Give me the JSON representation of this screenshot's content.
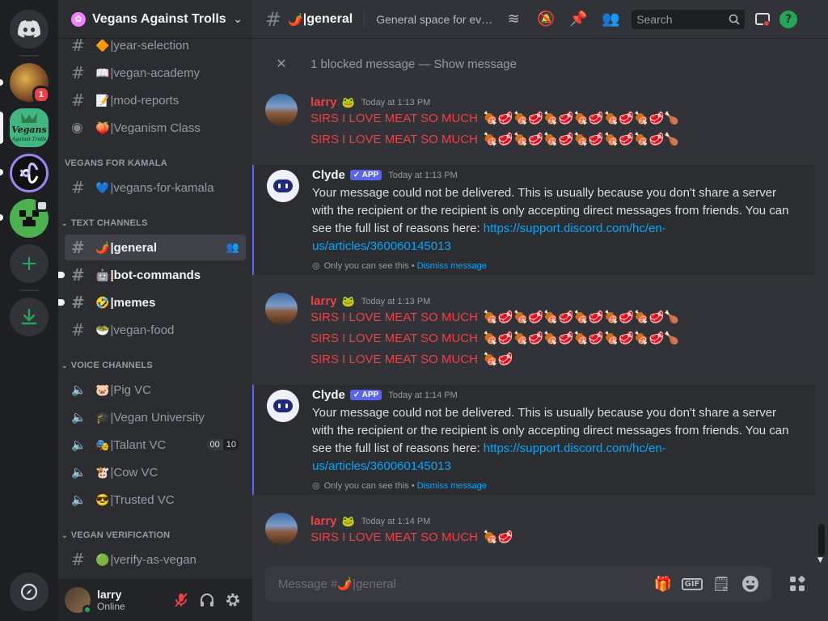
{
  "server": {
    "name": "Vegans Against Trolls"
  },
  "rail": {
    "mention_count": "1",
    "server_logo_text": "Vegans Against Trolls"
  },
  "channels": [
    {
      "type": "text",
      "emoji": "🔶",
      "name": "|year-selection",
      "active": false,
      "unread": false
    },
    {
      "type": "text",
      "emoji": "📖",
      "name": "|vegan-academy",
      "active": false,
      "unread": false
    },
    {
      "type": "text",
      "emoji": "📝",
      "name": "|mod-reports",
      "active": false,
      "unread": false
    },
    {
      "type": "stage",
      "emoji": "🍑",
      "name": "|Veganism Class",
      "active": false,
      "unread": false
    }
  ],
  "categories": {
    "kamala": "VEGANS FOR KAMALA",
    "text": "TEXT CHANNELS",
    "voice": "VOICE CHANNELS",
    "verification": "VEGAN VERIFICATION"
  },
  "kamala_channels": [
    {
      "emoji": "💙",
      "name": "|vegans-for-kamala"
    }
  ],
  "text_channels": [
    {
      "emoji": "🌶️",
      "name": "|general",
      "active": true,
      "unread": false
    },
    {
      "emoji": "🤖",
      "name": "|bot-commands",
      "active": false,
      "unread": true
    },
    {
      "emoji": "🤣",
      "name": "|memes",
      "active": false,
      "unread": true
    },
    {
      "emoji": "🥗",
      "name": "|vegan-food",
      "active": false,
      "unread": false
    }
  ],
  "voice_channels": [
    {
      "emoji": "🐷",
      "name": "|Pig VC",
      "count_a": "",
      "count_b": ""
    },
    {
      "emoji": "🎓",
      "name": "|Vegan University",
      "count_a": "",
      "count_b": ""
    },
    {
      "emoji": "🎭",
      "name": "|Talant VC",
      "count_a": "00",
      "count_b": "10"
    },
    {
      "emoji": "🐮",
      "name": "|Cow VC",
      "count_a": "",
      "count_b": ""
    },
    {
      "emoji": "😎",
      "name": "|Trusted VC",
      "count_a": "",
      "count_b": ""
    }
  ],
  "verification_channels": [
    {
      "emoji": "🟢",
      "name": "|verify-as-vegan"
    }
  ],
  "user": {
    "name": "larry",
    "status": "Online"
  },
  "topbar": {
    "channel_emoji": "🌶️",
    "channel_name": "|general",
    "topic": "General space for ever...",
    "search_placeholder": "Search"
  },
  "blocked": {
    "text": "1 blocked message — ",
    "action": "Show message"
  },
  "messages": [
    {
      "author": "larry",
      "badge": "🐸",
      "timestamp": "Today at 1:13 PM",
      "lines": [
        "SIRS I LOVE MEAT SO MUCH",
        "SIRS I LOVE MEAT SO MUCH"
      ],
      "meat": [
        "🍖🥩🍖🥩🍖🥩🍖🥩🍖🥩🍖🥩🍗",
        "🍖🥩🍖🥩🍖🥩🍖🥩🍖🥩🍖🥩🍗"
      ]
    },
    {
      "author": "Clyde",
      "app_tag": "✓ APP",
      "timestamp": "Today at 1:13 PM",
      "body_pre": "Your message could not be delivered. This is usually because you don't share a server with the recipient or the recipient is only accepting direct messages from friends. You can see the full list of reasons here: ",
      "link": "https://support.discord.com/hc/en-us/articles/360060145013",
      "only_you": "Only you can see this • ",
      "dismiss": "Dismiss message"
    },
    {
      "author": "larry",
      "badge": "🐸",
      "timestamp": "Today at 1:13 PM",
      "lines": [
        "SIRS I LOVE MEAT SO MUCH",
        "SIRS I LOVE MEAT SO MUCH",
        "SIRS I LOVE MEAT SO MUCH"
      ],
      "meat": [
        "🍖🥩🍖🥩🍖🥩🍖🥩🍖🥩🍖🥩🍗",
        "🍖🥩🍖🥩🍖🥩🍖🥩🍖🥩🍖🥩🍗",
        "🍖🥩"
      ]
    },
    {
      "author": "Clyde",
      "app_tag": "✓ APP",
      "timestamp": "Today at 1:14 PM",
      "body_pre": "Your message could not be delivered. This is usually because you don't share a server with the recipient or the recipient is only accepting direct messages from friends. You can see the full list of reasons here: ",
      "link": "https://support.discord.com/hc/en-us/articles/360060145013",
      "only_you": "Only you can see this • ",
      "dismiss": "Dismiss message"
    },
    {
      "author": "larry",
      "badge": "🐸",
      "timestamp": "Today at 1:14 PM",
      "lines": [
        "SIRS I LOVE MEAT SO MUCH"
      ],
      "meat": [
        "🍖🥩"
      ]
    }
  ],
  "composer": {
    "placeholder": "Message #🌶️|general"
  },
  "colors": {
    "accent": "#5865f2",
    "danger": "#f23f43",
    "online": "#23a55a",
    "link": "#00a8fc"
  }
}
